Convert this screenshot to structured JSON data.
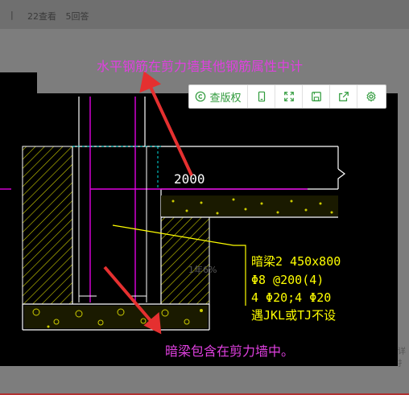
{
  "header": {
    "separator": "|",
    "views": "22查看",
    "answers": "5回答"
  },
  "annotations": {
    "top": "水平钢筋在剪力墙其他钢筋属性中计",
    "bottom": "暗梁包含在剪力墙中。"
  },
  "toolbar": {
    "copyright_label": "查版权",
    "icons": [
      "copyright-icon",
      "mobile-icon",
      "fullscreen-icon",
      "save-icon",
      "share-icon",
      "settings-icon"
    ]
  },
  "drawing": {
    "dimension": "2000",
    "beam_lines": [
      "暗梁2 450x800",
      "Φ8 @200(4)",
      "4 Φ20;4 Φ20",
      "遇JKL或TJ不设"
    ],
    "watermark": "1年6%",
    "right_clip": "详扌"
  },
  "colors": {
    "annotation": "#e040e0",
    "arrow": "#e53030",
    "toolbar_icon": "#2e9a3a",
    "cad_yellow": "#ffff00",
    "cad_magenta": "#e000e0",
    "cad_cyan": "#00e0e0"
  }
}
